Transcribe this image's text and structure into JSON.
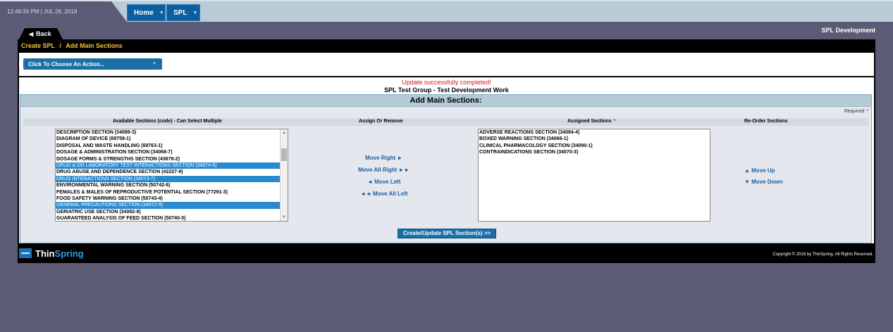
{
  "header": {
    "datetime": "12:48:39 PM | JUL 26, 2018",
    "nav": [
      {
        "label": "Home"
      },
      {
        "label": "SPL"
      }
    ],
    "app_title": "SPL Development",
    "back_label": "Back"
  },
  "breadcrumb": {
    "parent": "Create SPL",
    "separator": "/",
    "current": "Add Main Sections"
  },
  "action_menu": {
    "label": "Click To Choose An Action..."
  },
  "messages": {
    "success": "Update successfully completed!",
    "group_line": "SPL Test Group  - Test Development Work"
  },
  "form": {
    "title": "Add Main Sections:",
    "required_note": "Required",
    "required_star": "*",
    "columns": {
      "available": "Available Sections (code) - Can Select Multiple",
      "assign": "Assign Or Remove",
      "assigned": "Assigned Sections",
      "reorder": "Re-Order Sections"
    },
    "available_sections": [
      {
        "label": "DESCRIPTION SECTION (34089-3)",
        "selected": false
      },
      {
        "label": "DIAGRAM OF DEVICE (69758-1)",
        "selected": false
      },
      {
        "label": "DISPOSAL AND WASTE HANDLING (69763-1)",
        "selected": false
      },
      {
        "label": "DOSAGE & ADMINISTRATION SECTION (34068-7)",
        "selected": false
      },
      {
        "label": "DOSAGE FORMS & STRENGTHS SECTION (43678-2)",
        "selected": false
      },
      {
        "label": "DRUG & OR LABORATORY TEST INTERACTIONS SECTION (34074-5)",
        "selected": true
      },
      {
        "label": "DRUG ABUSE AND DEPENDENCE SECTION (42227-9)",
        "selected": false
      },
      {
        "label": "DRUG INTERACTIONS SECTION (34073-7)",
        "selected": true
      },
      {
        "label": "ENVIRONMENTAL WARNING SECTION (50742-6)",
        "selected": false
      },
      {
        "label": "FEMALES & MALES OF REPRODUCTIVE POTENTIAL SECTION (77291-3)",
        "selected": false
      },
      {
        "label": "FOOD SAFETY WARNING SECTION (50743-4)",
        "selected": false
      },
      {
        "label": "GENERAL PRECAUTIONS SECTION (34072-9)",
        "selected": true
      },
      {
        "label": "GERIATRIC USE SECTION (34082-8)",
        "selected": false
      },
      {
        "label": "GUARANTEED ANALYSIS OF FEED SECTION (50740-0)",
        "selected": false
      }
    ],
    "assigned_sections": [
      {
        "label": "ADVERSE REACTIONS SECTION (34084-4)"
      },
      {
        "label": "BOXED WARNING SECTION (34066-1)"
      },
      {
        "label": "CLINICAL PHARMACOLOGY SECTION (34090-1)"
      },
      {
        "label": "CONTRAINDICATIONS SECTION (34070-3)"
      }
    ],
    "assign_actions": {
      "move_right": "Move Right ►",
      "move_all_right": "Move All Right ►►",
      "move_left": "◄ Move Left",
      "move_all_left": "◄◄ Move All Left"
    },
    "reorder_actions": {
      "move_up": "▲ Move Up",
      "move_down": "▼ Move Down"
    },
    "submit_label": "Create/Update SPL Section(s) >>"
  },
  "footer": {
    "logo_thin": "Thin",
    "logo_spring": "Spring",
    "copyright": "Copyright © 2018 by ThinSpring. All Rights Reserved."
  },
  "colors": {
    "accent_blue": "#1a6fa6",
    "breadcrumb_gold": "#f3c23a",
    "success_red": "#d81818",
    "selection_blue": "#2a8ad0"
  }
}
